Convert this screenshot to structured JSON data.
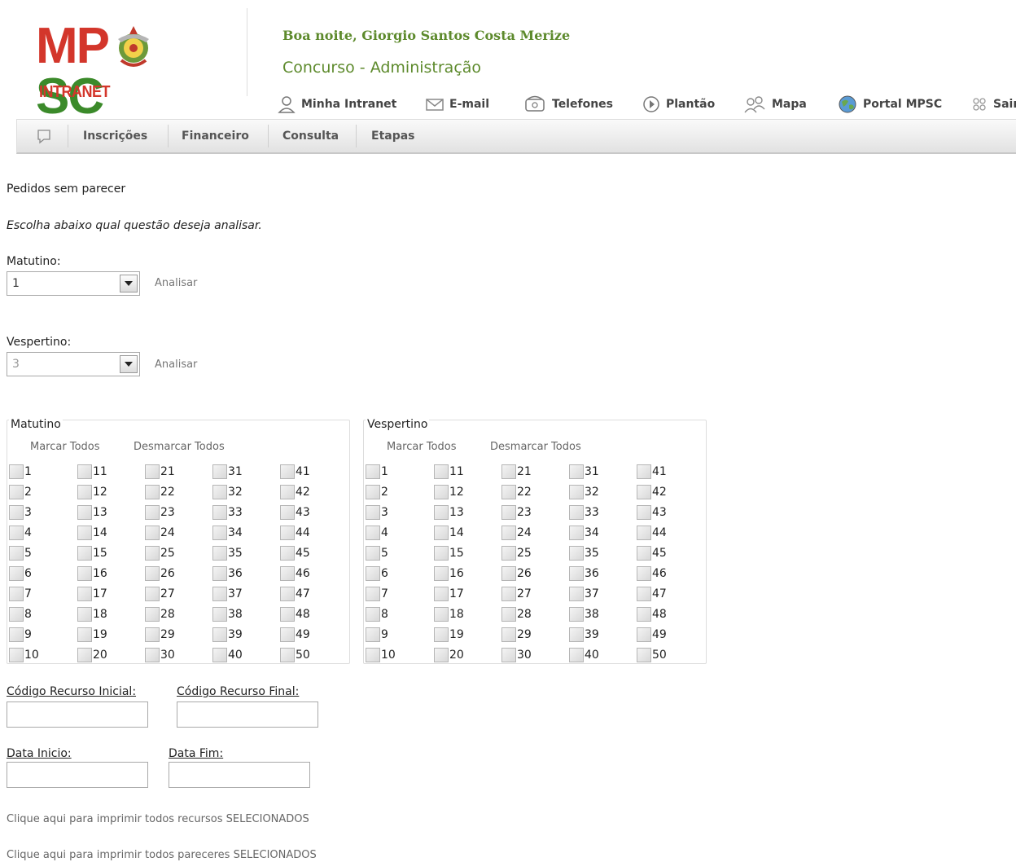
{
  "header": {
    "logo": {
      "main_left": "MP",
      "main_right": "SC",
      "subtitle": "INTRANET"
    },
    "greeting": "Boa noite, Giorgio Santos Costa Merize",
    "section_title": "Concurso - Administração",
    "top_nav": [
      {
        "label": "Minha Intranet",
        "icon": "user-icon"
      },
      {
        "label": "E-mail",
        "icon": "mail-icon"
      },
      {
        "label": "Telefones",
        "icon": "phone-icon"
      },
      {
        "label": "Plantão",
        "icon": "play-icon"
      },
      {
        "label": "Mapa",
        "icon": "people-icon"
      },
      {
        "label": "Portal MPSC",
        "icon": "globe-icon"
      },
      {
        "label": "Sair",
        "icon": "exit-icon"
      }
    ]
  },
  "menubar": {
    "home_icon": "home-icon",
    "items": [
      "Inscrições",
      "Financeiro",
      "Consulta",
      "Etapas"
    ]
  },
  "page": {
    "heading": "Pedidos sem parecer",
    "instruction": "Escolha abaixo qual questão deseja analisar."
  },
  "selectors": {
    "morning": {
      "label": "Matutino:",
      "value": "1",
      "action": "Analisar"
    },
    "afternoon": {
      "label": "Vespertino:",
      "value": "3",
      "action": "Analisar"
    }
  },
  "groups": {
    "morning": {
      "legend": "Matutino",
      "mark_all": "Marcar Todos",
      "unmark_all": "Desmarcar Todos"
    },
    "afternoon": {
      "legend": "Vespertino",
      "mark_all": "Marcar Todos",
      "unmark_all": "Desmarcar Todos"
    }
  },
  "questions": [
    "1",
    "2",
    "3",
    "4",
    "5",
    "6",
    "7",
    "8",
    "9",
    "10",
    "11",
    "12",
    "13",
    "14",
    "15",
    "16",
    "17",
    "18",
    "19",
    "20",
    "21",
    "22",
    "23",
    "24",
    "25",
    "26",
    "27",
    "28",
    "29",
    "30",
    "31",
    "32",
    "33",
    "34",
    "35",
    "36",
    "37",
    "38",
    "39",
    "40",
    "41",
    "42",
    "43",
    "44",
    "45",
    "46",
    "47",
    "48",
    "49",
    "50"
  ],
  "filters": {
    "code_start": {
      "label": "Código Recurso Inicial:",
      "value": ""
    },
    "code_end": {
      "label": "Código Recurso Final:",
      "value": ""
    },
    "date_start": {
      "label": "Data Inicio:",
      "value": ""
    },
    "date_end": {
      "label": "Data Fim:",
      "value": ""
    }
  },
  "print_links": {
    "appeals": "Clique aqui para imprimir todos recursos SELECIONADOS",
    "opinions": "Clique aqui para imprimir todos pareceres SELECIONADOS"
  }
}
